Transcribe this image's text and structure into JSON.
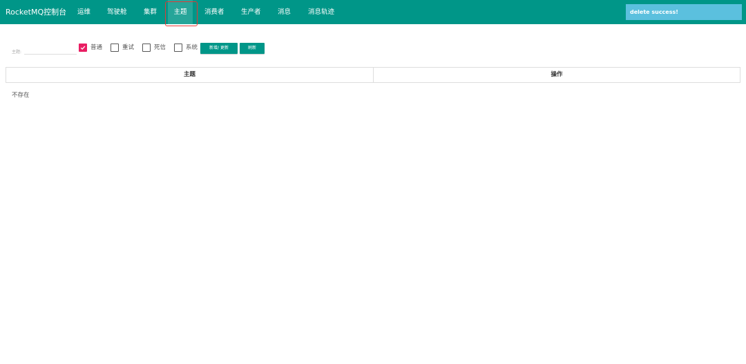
{
  "navbar": {
    "brand": "RocketMQ控制台",
    "items": [
      {
        "label": "运维"
      },
      {
        "label": "驾驶舱"
      },
      {
        "label": "集群"
      },
      {
        "label": "主题"
      },
      {
        "label": "消费者"
      },
      {
        "label": "生产者"
      },
      {
        "label": "消息"
      },
      {
        "label": "消息轨迹"
      }
    ],
    "active_item": "主题",
    "color": "#009688"
  },
  "toast": {
    "message": "delete success!",
    "color": "#5bc0de"
  },
  "filter": {
    "topic_label": "主题:",
    "topic_value": "",
    "checkboxes": [
      {
        "label": "普通",
        "checked": true
      },
      {
        "label": "重试",
        "checked": false
      },
      {
        "label": "死信",
        "checked": false
      },
      {
        "label": "系统",
        "checked": false
      }
    ],
    "checkbox_checked_color": "#e91e63",
    "add_update_button": "新增/ 更新",
    "refresh_button": "刷新"
  },
  "table": {
    "columns": [
      "主题",
      "操作"
    ],
    "empty_text": "不存在"
  },
  "annotation": {
    "highlight_color": "#e53935"
  }
}
